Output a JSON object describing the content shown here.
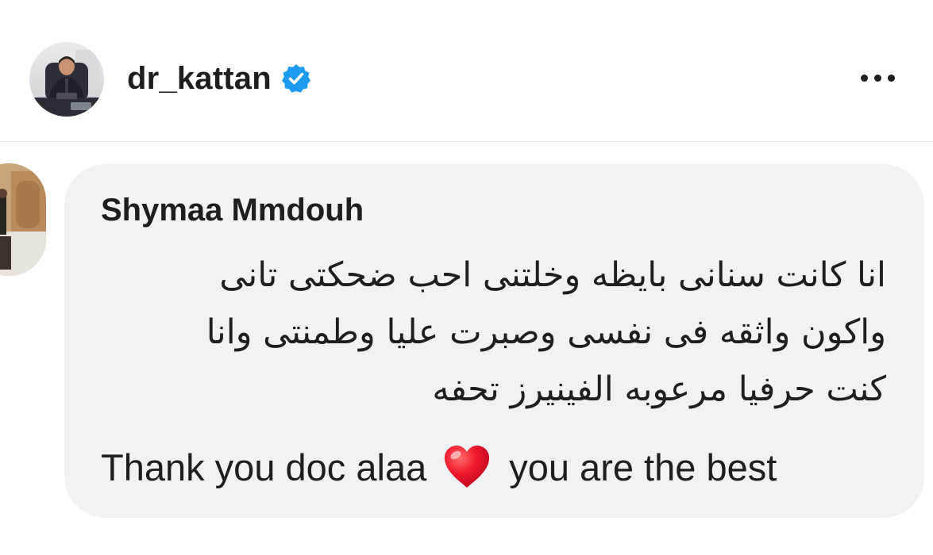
{
  "post": {
    "author_name": "dr_kattan",
    "verified_icon": "verified-badge-icon",
    "more_icon": "more-options-icon"
  },
  "comment": {
    "author_name": "Shymaa Mmdouh",
    "text_lines": [
      "انا كانت سنانى بايظه وخلتنى احب ضحكتى تانى",
      "واكون واثقه فى نفسى  وصبرت عليا وطمنتى وانا",
      "كنت حرفيا مرعوبه  الفينيرز تحفه"
    ],
    "english_before": "Thank you doc alaa",
    "english_after": "you are the best",
    "emoji": "red-heart-icon"
  },
  "colors": {
    "verified": "#1d9bf0",
    "bubble": "#f0f2f5",
    "heart": "#e8112d"
  }
}
